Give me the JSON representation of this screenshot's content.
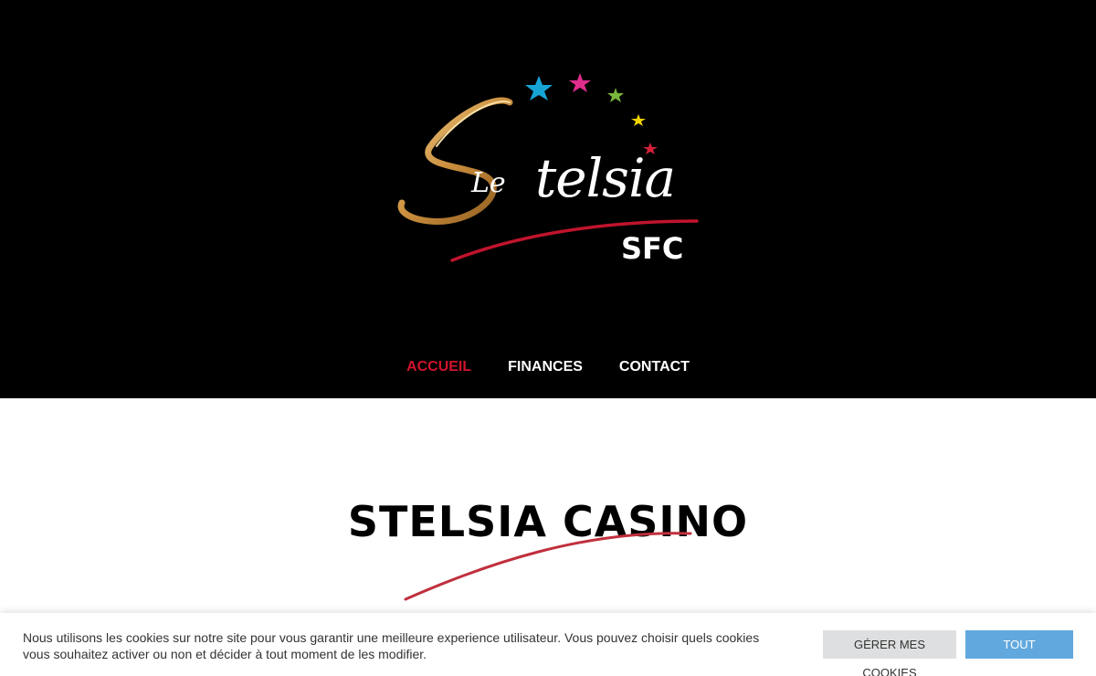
{
  "brand": {
    "logo_le": "Le",
    "logo_telsia": "telsia",
    "logo_sfc": "SFC",
    "gold_color": "#c98d3c",
    "red_color": "#c0142c",
    "star_colors": [
      "#16a4d6",
      "#e02d8c",
      "#7ab53b",
      "#f2d400",
      "#d6203a"
    ]
  },
  "nav": {
    "items": [
      {
        "label": "ACCUEIL",
        "active": true
      },
      {
        "label": "FINANCES",
        "active": false
      },
      {
        "label": "CONTACT",
        "active": false
      }
    ],
    "active_color": "#d0142c"
  },
  "main": {
    "title": "STELSIA CASINO",
    "accent_color": "#c0303d"
  },
  "cookie": {
    "text": "Nous utilisons les cookies sur notre site pour vous garantir une meilleure experience utilisateur. Vous pouvez choisir quels cookies vous souhaitez activer ou non et décider à tout moment de les modifier.",
    "manage_label": "GÉRER MES COOKIES",
    "accept_label": "TOUT ACCEPTER",
    "accept_color": "#61a8de",
    "manage_color": "#dedfe0"
  }
}
